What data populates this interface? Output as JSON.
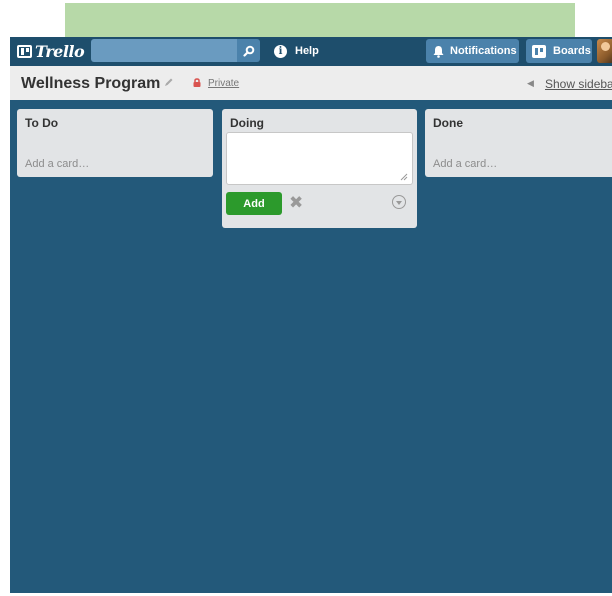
{
  "header": {
    "logo_text": "Trello",
    "search": {
      "value": "",
      "placeholder": ""
    },
    "help_label": "Help",
    "notifications_label": "Notifications",
    "boards_label": "Boards"
  },
  "board": {
    "title": "Wellness Program",
    "visibility": "Private",
    "show_sidebar": "Show sidebar"
  },
  "lists": [
    {
      "title": "To Do",
      "add_card": "Add a card…"
    },
    {
      "title": "Doing",
      "composer_value": "",
      "add_button": "Add"
    },
    {
      "title": "Done",
      "add_card": "Add a card…"
    }
  ],
  "colors": {
    "board_bg": "#23597a",
    "header_bg": "#1e4e6c",
    "add_button": "#2c9a2c"
  }
}
